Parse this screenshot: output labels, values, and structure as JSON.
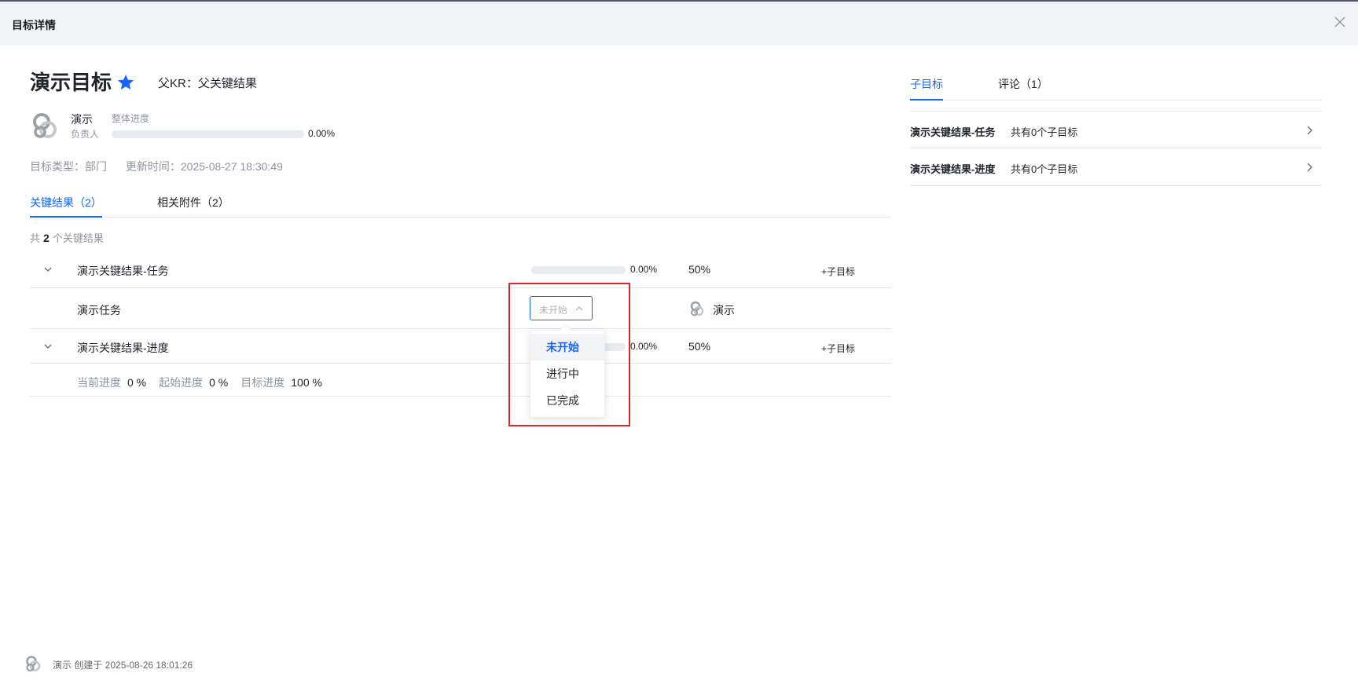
{
  "modal": {
    "title": "目标详情"
  },
  "objective": {
    "title": "演示目标",
    "parent_kr": "父KR：父关键结果",
    "owner_name": "演示",
    "owner_role": "负责人",
    "progress_label": "整体进度",
    "progress_value": "0.00%",
    "progress_fraction": 0,
    "type": "目标类型：部门",
    "updated": "更新时间：2025-08-27 18:30:49"
  },
  "tabs_left": [
    {
      "label": "关键结果（2）",
      "active": true
    },
    {
      "label": "相关附件（2）",
      "active": false
    }
  ],
  "kr_summary": {
    "prefix": "共",
    "count": "2",
    "suffix": "个关键结果"
  },
  "key_results": [
    {
      "title": "演示关键结果-任务",
      "progress": "0.00%",
      "weight": "50%",
      "add_child": "+子目标"
    },
    {
      "title": "演示关键结果-进度",
      "progress": "0.00%",
      "weight": "50%",
      "add_child": "+子目标"
    }
  ],
  "task": {
    "title": "演示任务",
    "status_placeholder": "未开始",
    "owner": "演示"
  },
  "progress_detail": {
    "current_label": "当前进度",
    "current_value": "0 %",
    "start_label": "起始进度",
    "start_value": "0 %",
    "target_label": "目标进度",
    "target_value": "100 %"
  },
  "status_dropdown": {
    "options": [
      {
        "label": "未开始",
        "selected": true
      },
      {
        "label": "进行中",
        "selected": false
      },
      {
        "label": "已完成",
        "selected": false
      }
    ]
  },
  "tabs_right": [
    {
      "label": "子目标",
      "active": true
    },
    {
      "label": "评论（1）",
      "active": false
    }
  ],
  "child_objectives": [
    {
      "title": "演示关键结果-任务",
      "count": "共有0个子目标"
    },
    {
      "title": "演示关键结果-进度",
      "count": "共有0个子目标"
    }
  ],
  "footer": {
    "text": "演示 创建于 2025-08-26 18:01:26"
  },
  "colors": {
    "accent": "#1664ff",
    "highlight": "#e0262c",
    "star": "#1664ff"
  }
}
